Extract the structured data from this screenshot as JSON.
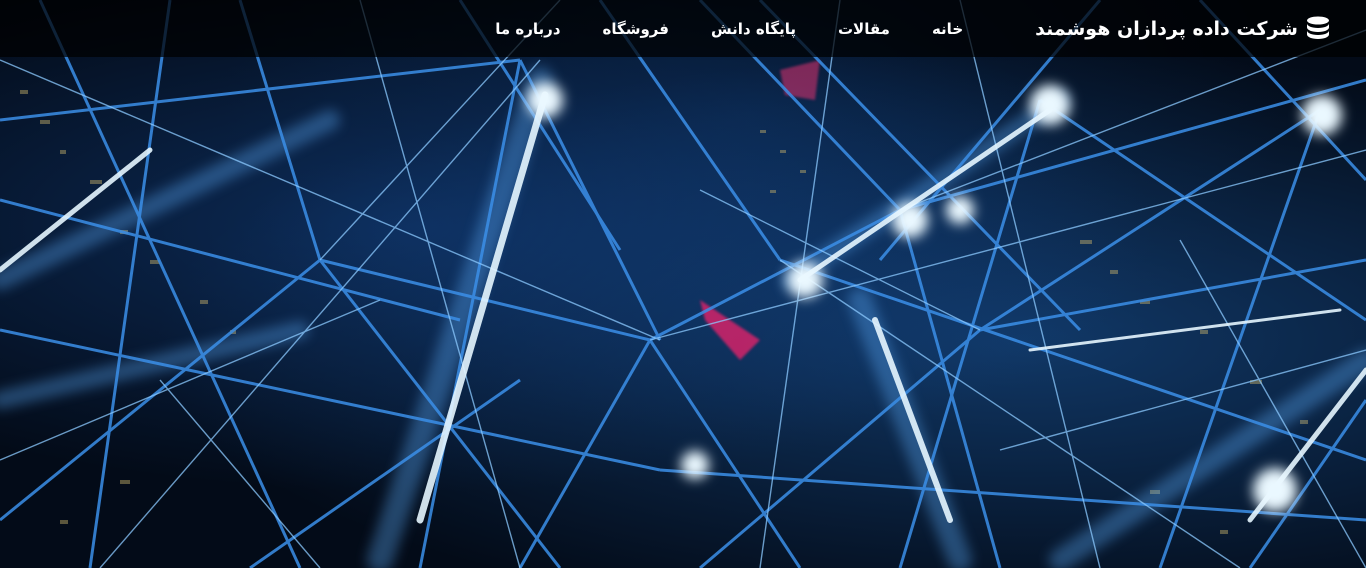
{
  "navbar": {
    "brand_label": "شرکت داده پردازان هوشمند",
    "brand_icon": "database-icon",
    "links": [
      {
        "label": "خانه"
      },
      {
        "label": "مقالات"
      },
      {
        "label": "پایگاه دانش"
      },
      {
        "label": "فروشگاه"
      },
      {
        "label": "درباره ما"
      }
    ]
  },
  "hero": {
    "image": "network-lines-city-night-background"
  },
  "colors": {
    "navbar_bg": "#000000",
    "nav_text": "#ffffff",
    "accent_glow": "#8fd4ff",
    "line_blue": "#2f7fd8"
  }
}
